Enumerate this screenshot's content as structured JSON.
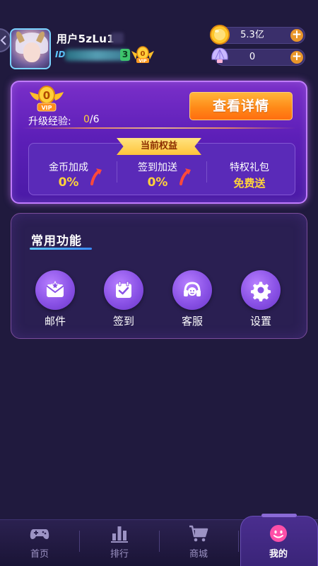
{
  "header": {
    "username": "用户5zLu1",
    "id_label": "ID",
    "level": "3",
    "vip_badge_text": "VIP"
  },
  "currency": {
    "gold_value": "5.3亿",
    "shell_value": "0",
    "plus": "+"
  },
  "vip_card": {
    "vip_level": "0",
    "vip_text": "VIP",
    "exp_label": "升级经验:",
    "exp_current": "0",
    "exp_total": "/6",
    "detail_button": "查看详情",
    "benefits_ribbon": "当前权益",
    "benefits": [
      {
        "title": "金币加成",
        "value": "0%"
      },
      {
        "title": "签到加送",
        "value": "0%"
      },
      {
        "title": "特权礼包",
        "value": "免费送"
      }
    ]
  },
  "functions": {
    "title": "常用功能",
    "items": [
      {
        "label": "邮件",
        "icon": "mail-icon"
      },
      {
        "label": "签到",
        "icon": "calendar-check-icon"
      },
      {
        "label": "客服",
        "icon": "headset-icon"
      },
      {
        "label": "设置",
        "icon": "gear-icon"
      }
    ]
  },
  "nav": {
    "items": [
      {
        "label": "首页",
        "icon": "gamepad-icon"
      },
      {
        "label": "排行",
        "icon": "bar-chart-icon"
      },
      {
        "label": "商城",
        "icon": "cart-icon"
      },
      {
        "label": "我的",
        "icon": "smiley-icon"
      }
    ],
    "active_index": 3
  },
  "colors": {
    "background": "#201a3e",
    "accent_orange": "#ff8a18",
    "accent_yellow": "#ffd23a",
    "vip_purple": "#6a22c0",
    "function_purple": "#8a52e6"
  }
}
